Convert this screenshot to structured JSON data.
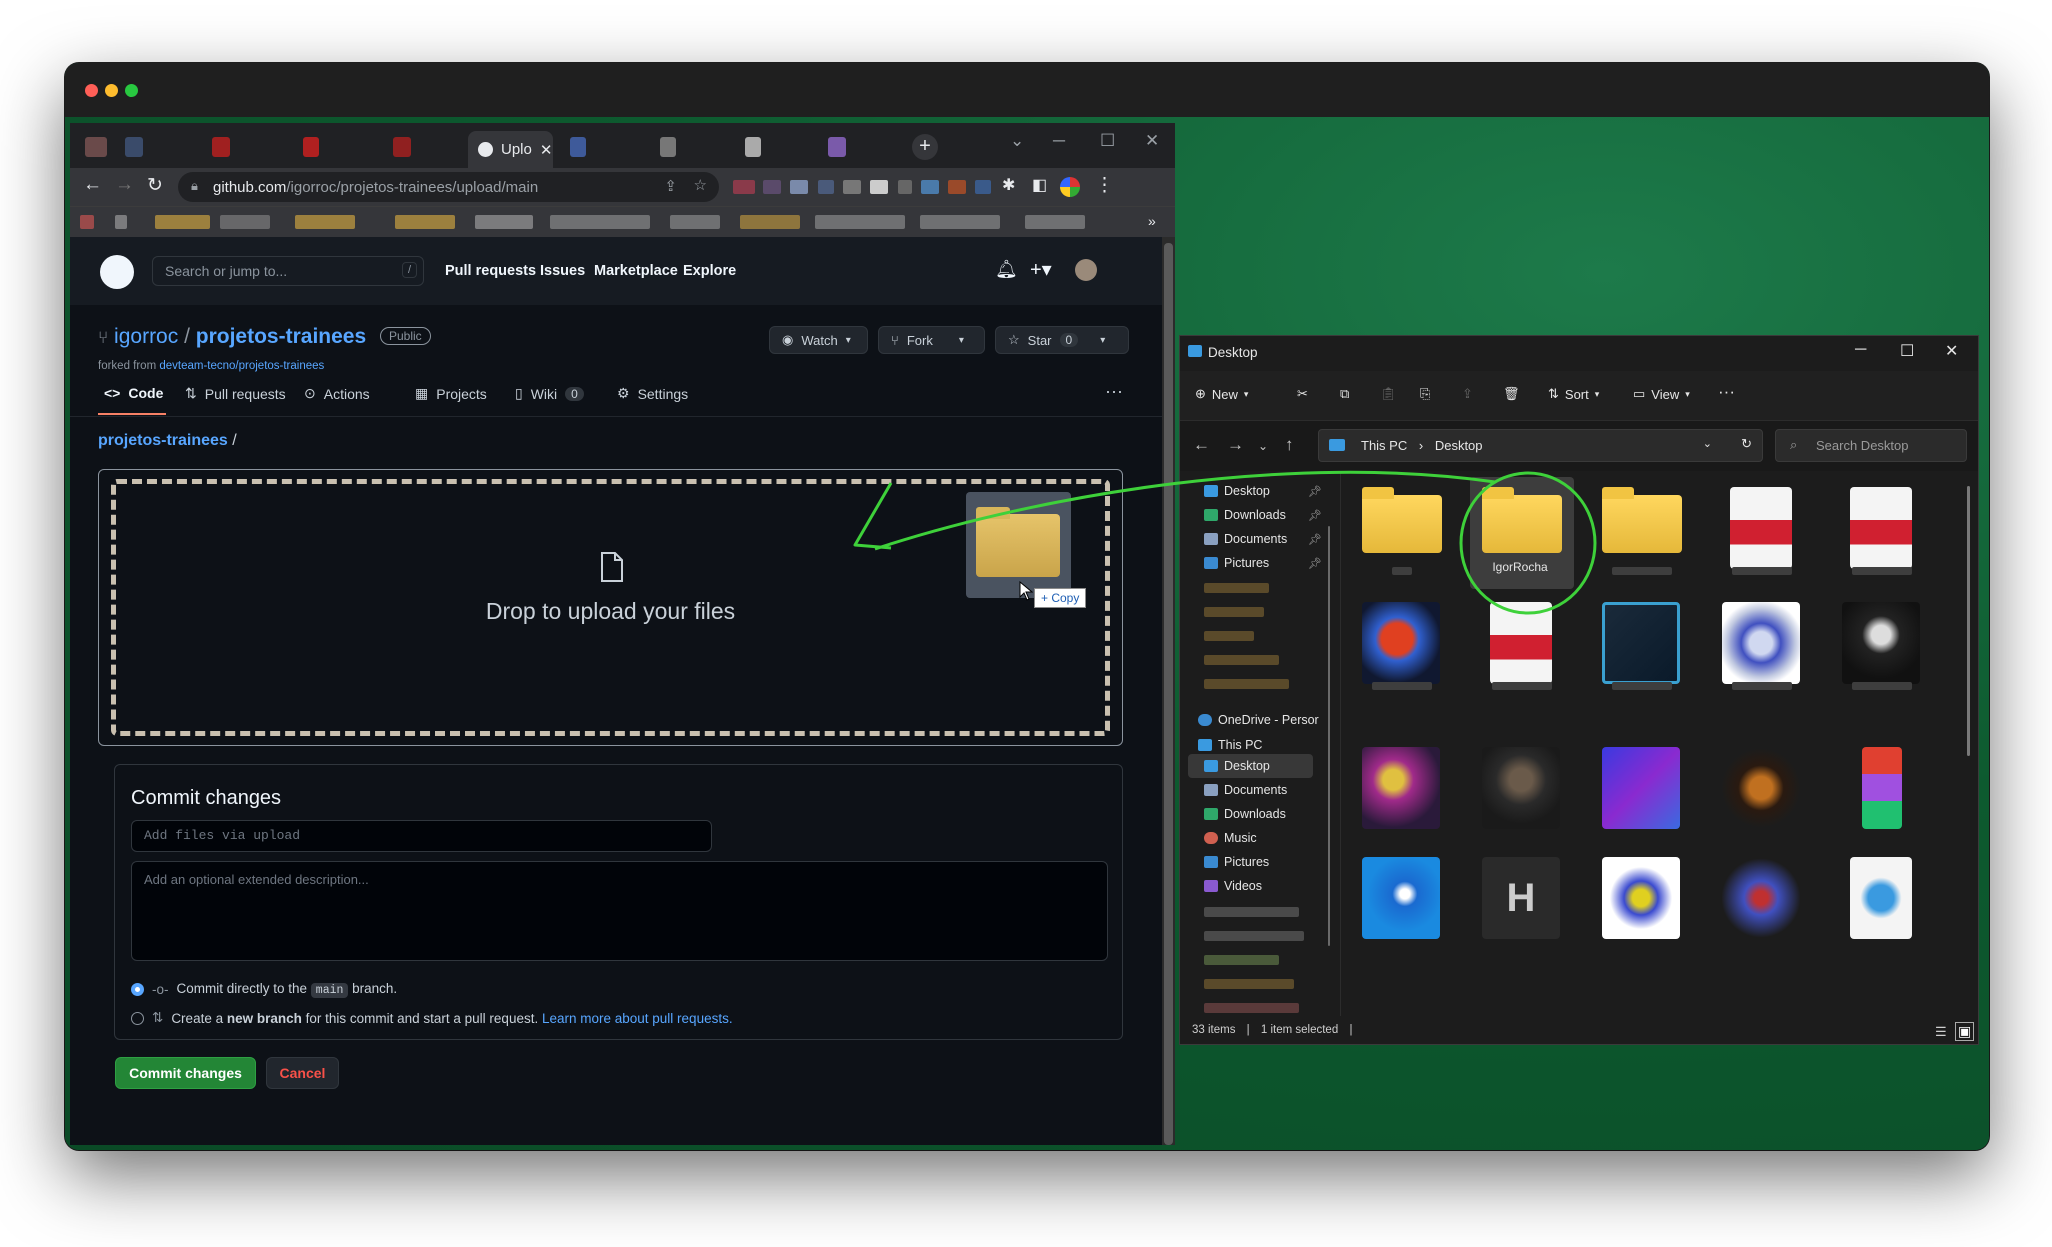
{
  "browser": {
    "active_tab_label": "Uplo",
    "url_domain": "github.com",
    "url_path": "/igorroc/projetos-trainees/upload/main"
  },
  "github": {
    "search_placeholder": "Search or jump to...",
    "search_shortcut": "/",
    "nav": [
      "Pull requests",
      "Issues",
      "Marketplace",
      "Explore"
    ],
    "repo_owner": "igorroc",
    "repo_sep": " / ",
    "repo_name": "projetos-trainees",
    "visibility": "Public",
    "forked_from_label": "forked from ",
    "forked_from": "devteam-tecno/projetos-trainees",
    "watch_label": "Watch",
    "fork_label": "Fork",
    "star_label": "Star",
    "star_count": "0",
    "tabs": [
      "Code",
      "Pull requests",
      "Actions",
      "Projects",
      "Wiki",
      "Settings"
    ],
    "wiki_count": "0",
    "breadcrumb_repo": "projetos-trainees",
    "breadcrumb_sep": " /",
    "drop_text": "Drop to upload your files",
    "copy_badge": "+ Copy",
    "commit_title": "Commit changes",
    "commit_placeholder": "Add files via upload",
    "description_placeholder": "Add an optional extended description...",
    "radio1_pre": "Commit directly to the ",
    "radio1_branch": "main",
    "radio1_post": " branch.",
    "radio2_pre": "Create a ",
    "radio2_bold": "new branch",
    "radio2_post": " for this commit and start a pull request. ",
    "radio2_link": "Learn more about pull requests.",
    "commit_button": "Commit changes",
    "cancel_button": "Cancel"
  },
  "explorer": {
    "title": "Desktop",
    "cmd_new": "New",
    "cmd_sort": "Sort",
    "cmd_view": "View",
    "address_this_pc": "This PC",
    "address_desktop": "Desktop",
    "search_placeholder": "Search Desktop",
    "quick_access": [
      "Desktop",
      "Downloads",
      "Documents",
      "Pictures"
    ],
    "onedrive": "OneDrive - Persor",
    "this_pc": "This PC",
    "this_pc_items": [
      "Desktop",
      "Documents",
      "Downloads",
      "Music",
      "Pictures",
      "Videos"
    ],
    "selected_folder_name": "IgorRocha",
    "status_items": "33 items",
    "status_selected": "1 item selected"
  }
}
